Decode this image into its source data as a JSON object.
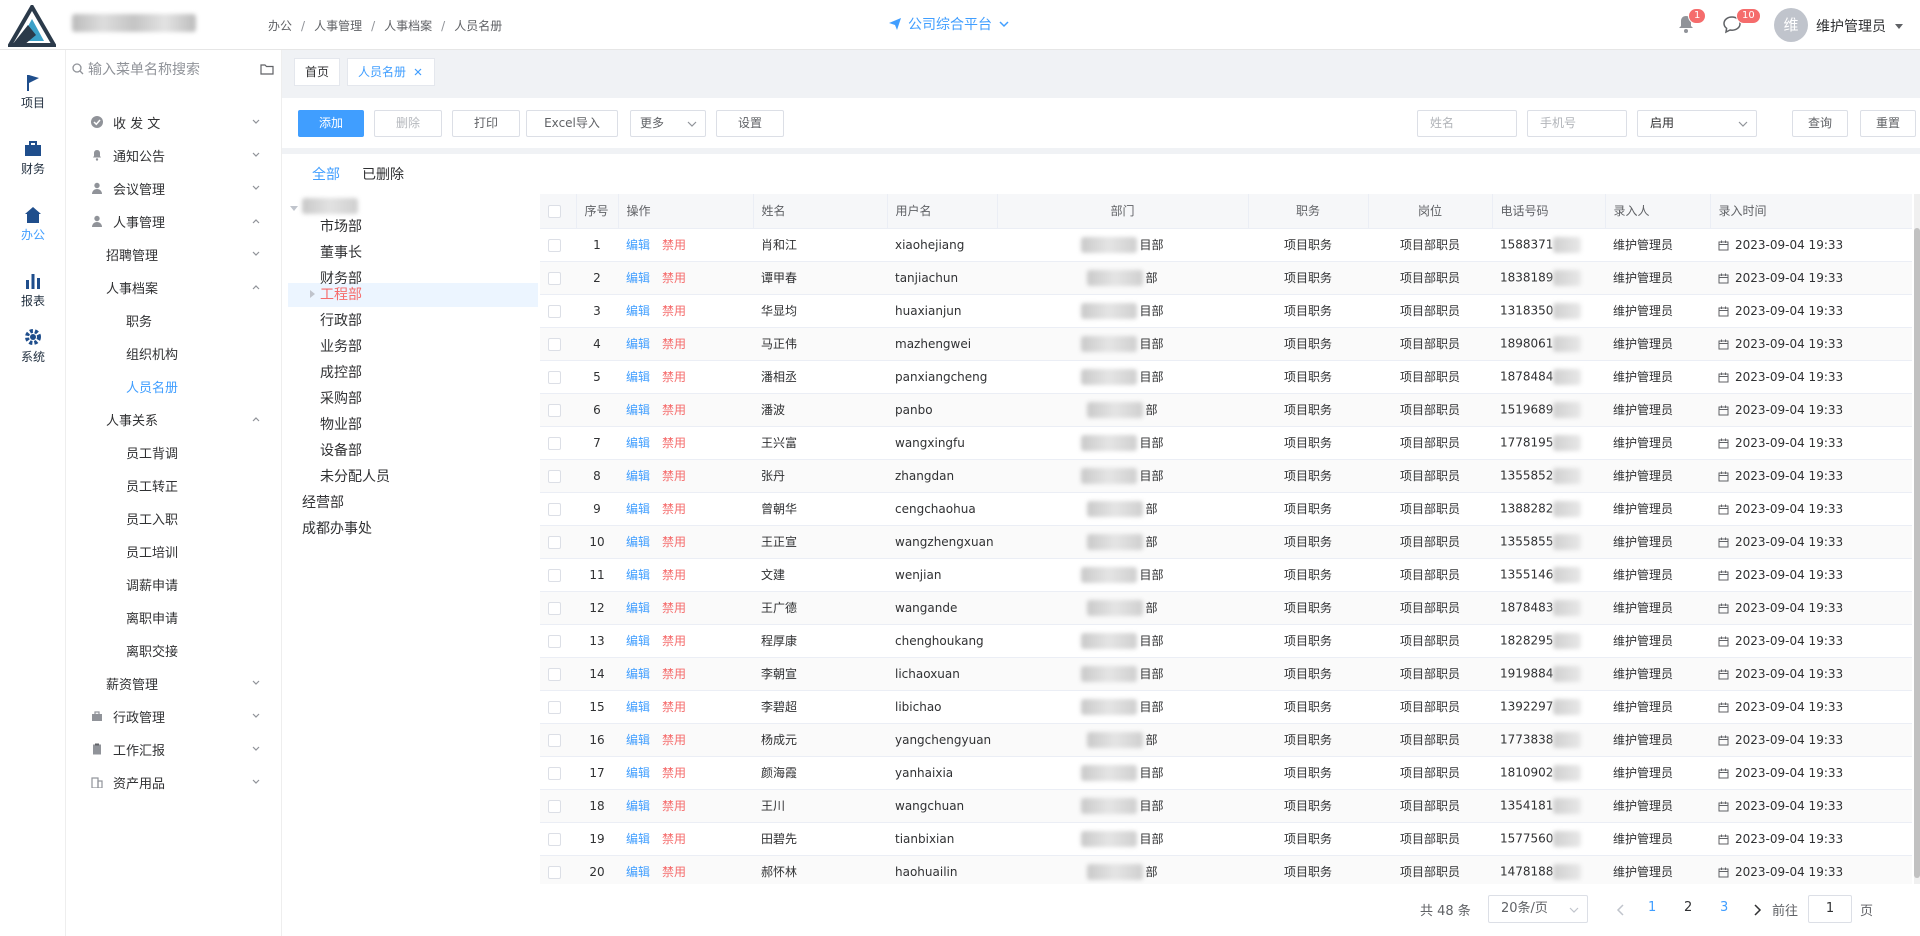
{
  "header": {
    "breadcrumb": [
      "办公",
      "人事管理",
      "人事档案",
      "人员名册"
    ],
    "platform": "公司综合平台",
    "notif_badge": "1",
    "msg_badge": "10",
    "avatar_char": "维",
    "username": "维护管理员"
  },
  "rail": [
    {
      "label": "项目"
    },
    {
      "label": "财务"
    },
    {
      "label": "办公"
    },
    {
      "label": "报表"
    },
    {
      "label": "系统"
    }
  ],
  "menu": {
    "search_placeholder": "输入菜单名称搜索",
    "items": [
      {
        "label": "收 发 文"
      },
      {
        "label": "通知公告"
      },
      {
        "label": "会议管理"
      },
      {
        "label": "人事管理"
      },
      {
        "label": "招聘管理"
      },
      {
        "label": "人事档案"
      },
      {
        "label": "职务"
      },
      {
        "label": "组织机构"
      },
      {
        "label": "人员名册"
      },
      {
        "label": "人事关系"
      },
      {
        "label": "员工背调"
      },
      {
        "label": "员工转正"
      },
      {
        "label": "员工入职"
      },
      {
        "label": "员工培训"
      },
      {
        "label": "调薪申请"
      },
      {
        "label": "离职申请"
      },
      {
        "label": "离职交接"
      },
      {
        "label": "薪资管理"
      },
      {
        "label": "行政管理"
      },
      {
        "label": "工作汇报"
      },
      {
        "label": "资产用品"
      }
    ]
  },
  "tabs": {
    "home": "首页",
    "current": "人员名册"
  },
  "toolbar": {
    "add": "添加",
    "delete": "删除",
    "print": "打印",
    "excel": "Excel导入",
    "more": "更多",
    "settings": "设置",
    "name_ph": "姓名",
    "phone_ph": "手机号",
    "status": "启用",
    "query": "查询",
    "reset": "重置"
  },
  "subtabs": {
    "all": "全部",
    "deleted": "已删除"
  },
  "tree": [
    "市场部",
    "董事长",
    "财务部",
    "工程部",
    "行政部",
    "业务部",
    "成控部",
    "采购部",
    "物业部",
    "设备部",
    "未分配人员",
    "经营部",
    "成都办事处"
  ],
  "table": {
    "columns": [
      "序号",
      "操作",
      "姓名",
      "用户名",
      "部门",
      "职务",
      "岗位",
      "电话号码",
      "录入人",
      "录入时间"
    ],
    "edit_label": "编辑",
    "disable_label": "禁用",
    "rows": [
      {
        "no": "1",
        "name": "肖和江",
        "user": "xiaohejiang",
        "dept": "目部",
        "duty": "项目职务",
        "post": "项目部职员",
        "tel": "1588371",
        "by": "维护管理员",
        "time": "2023-09-04 19:33"
      },
      {
        "no": "2",
        "name": "谭甲春",
        "user": "tanjiachun",
        "dept": "部",
        "duty": "项目职务",
        "post": "项目部职员",
        "tel": "1838189",
        "by": "维护管理员",
        "time": "2023-09-04 19:33"
      },
      {
        "no": "3",
        "name": "华显均",
        "user": "huaxianjun",
        "dept": "目部",
        "duty": "项目职务",
        "post": "项目部职员",
        "tel": "1318350",
        "by": "维护管理员",
        "time": "2023-09-04 19:33"
      },
      {
        "no": "4",
        "name": "马正伟",
        "user": "mazhengwei",
        "dept": "目部",
        "duty": "项目职务",
        "post": "项目部职员",
        "tel": "1898061",
        "by": "维护管理员",
        "time": "2023-09-04 19:33"
      },
      {
        "no": "5",
        "name": "潘相丞",
        "user": "panxiangcheng",
        "dept": "目部",
        "duty": "项目职务",
        "post": "项目部职员",
        "tel": "1878484",
        "by": "维护管理员",
        "time": "2023-09-04 19:33"
      },
      {
        "no": "6",
        "name": "潘波",
        "user": "panbo",
        "dept": "部",
        "duty": "项目职务",
        "post": "项目部职员",
        "tel": "1519689",
        "by": "维护管理员",
        "time": "2023-09-04 19:33"
      },
      {
        "no": "7",
        "name": "王兴富",
        "user": "wangxingfu",
        "dept": "目部",
        "duty": "项目职务",
        "post": "项目部职员",
        "tel": "1778195",
        "by": "维护管理员",
        "time": "2023-09-04 19:33"
      },
      {
        "no": "8",
        "name": "张丹",
        "user": "zhangdan",
        "dept": "目部",
        "duty": "项目职务",
        "post": "项目部职员",
        "tel": "1355852",
        "by": "维护管理员",
        "time": "2023-09-04 19:33"
      },
      {
        "no": "9",
        "name": "曾朝华",
        "user": "cengchaohua",
        "dept": "部",
        "duty": "项目职务",
        "post": "项目部职员",
        "tel": "1388282",
        "by": "维护管理员",
        "time": "2023-09-04 19:33"
      },
      {
        "no": "10",
        "name": "王正宣",
        "user": "wangzhengxuan",
        "dept": "部",
        "duty": "项目职务",
        "post": "项目部职员",
        "tel": "1355855",
        "by": "维护管理员",
        "time": "2023-09-04 19:33"
      },
      {
        "no": "11",
        "name": "文建",
        "user": "wenjian",
        "dept": "目部",
        "duty": "项目职务",
        "post": "项目部职员",
        "tel": "1355146",
        "by": "维护管理员",
        "time": "2023-09-04 19:33"
      },
      {
        "no": "12",
        "name": "王广德",
        "user": "wangande",
        "dept": "部",
        "duty": "项目职务",
        "post": "项目部职员",
        "tel": "1878483",
        "by": "维护管理员",
        "time": "2023-09-04 19:33"
      },
      {
        "no": "13",
        "name": "程厚康",
        "user": "chenghoukang",
        "dept": "目部",
        "duty": "项目职务",
        "post": "项目部职员",
        "tel": "1828295",
        "by": "维护管理员",
        "time": "2023-09-04 19:33"
      },
      {
        "no": "14",
        "name": "李朝宣",
        "user": "lichaoxuan",
        "dept": "目部",
        "duty": "项目职务",
        "post": "项目部职员",
        "tel": "1919884",
        "by": "维护管理员",
        "time": "2023-09-04 19:33"
      },
      {
        "no": "15",
        "name": "李碧超",
        "user": "libichao",
        "dept": "目部",
        "duty": "项目职务",
        "post": "项目部职员",
        "tel": "1392297",
        "by": "维护管理员",
        "time": "2023-09-04 19:33"
      },
      {
        "no": "16",
        "name": "杨成元",
        "user": "yangchengyuan",
        "dept": "部",
        "duty": "项目职务",
        "post": "项目部职员",
        "tel": "1773838",
        "by": "维护管理员",
        "time": "2023-09-04 19:33"
      },
      {
        "no": "17",
        "name": "颜海霞",
        "user": "yanhaixia",
        "dept": "目部",
        "duty": "项目职务",
        "post": "项目部职员",
        "tel": "1810902",
        "by": "维护管理员",
        "time": "2023-09-04 19:33"
      },
      {
        "no": "18",
        "name": "王川",
        "user": "wangchuan",
        "dept": "目部",
        "duty": "项目职务",
        "post": "项目部职员",
        "tel": "1354181",
        "by": "维护管理员",
        "time": "2023-09-04 19:33"
      },
      {
        "no": "19",
        "name": "田碧先",
        "user": "tianbixian",
        "dept": "目部",
        "duty": "项目职务",
        "post": "项目部职员",
        "tel": "1577560",
        "by": "维护管理员",
        "time": "2023-09-04 19:33"
      },
      {
        "no": "20",
        "name": "郝怀林",
        "user": "haohuailin",
        "dept": "部",
        "duty": "项目职务",
        "post": "项目部职员",
        "tel": "1478188",
        "by": "维护管理员",
        "time": "2023-09-04 19:33"
      }
    ]
  },
  "pagination": {
    "total": "共 48 条",
    "page_size": "20条/页",
    "pages": [
      "1",
      "2",
      "3"
    ],
    "goto": "前往",
    "goto_value": "1",
    "page_unit": "页"
  },
  "colors": {
    "primary": "#409eff",
    "danger": "#f56c6c"
  }
}
